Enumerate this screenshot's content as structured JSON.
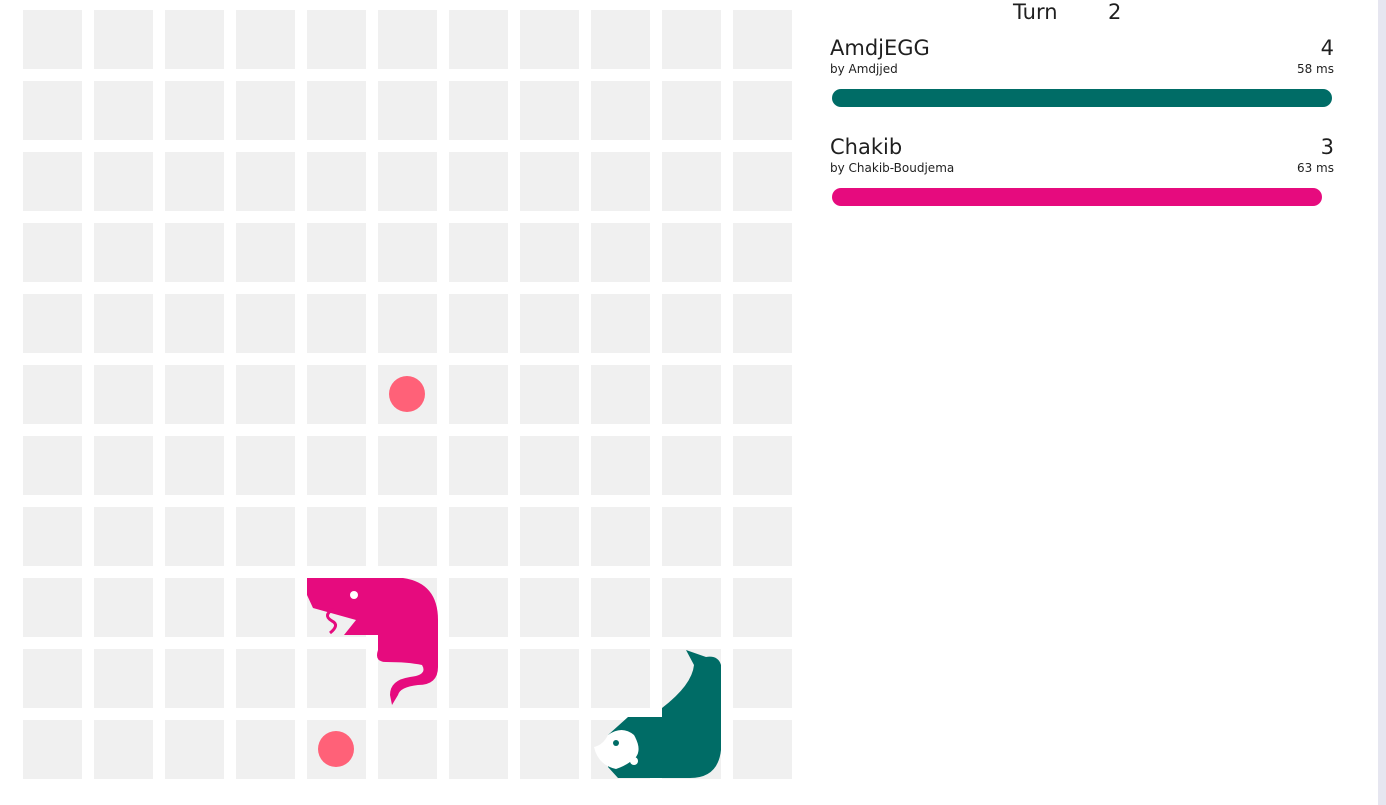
{
  "game": {
    "turn_label": "Turn",
    "turn_value": "2",
    "board_cols": 11,
    "board_rows": 11,
    "food": [
      {
        "col": 5,
        "row": 5
      },
      {
        "col": 4,
        "row": 10
      }
    ]
  },
  "players": [
    {
      "name": "AmdjEGG",
      "author": "by Amdjjed",
      "score": "4",
      "latency": "58 ms",
      "health": 1.0,
      "color": "#006c66",
      "head_icon": "bear-head-icon",
      "tail_icon": "curled-tail-icon"
    },
    {
      "name": "Chakib",
      "author": "by Chakib-Boudjema",
      "score": "3",
      "latency": "63 ms",
      "health": 0.98,
      "color": "#e60b7e",
      "head_icon": "snake-tongue-head-icon",
      "tail_icon": "curly-tail-icon"
    }
  ],
  "colors": {
    "cell": "#f0f0f0",
    "food": "#ff6178",
    "background": "#ffffff"
  }
}
